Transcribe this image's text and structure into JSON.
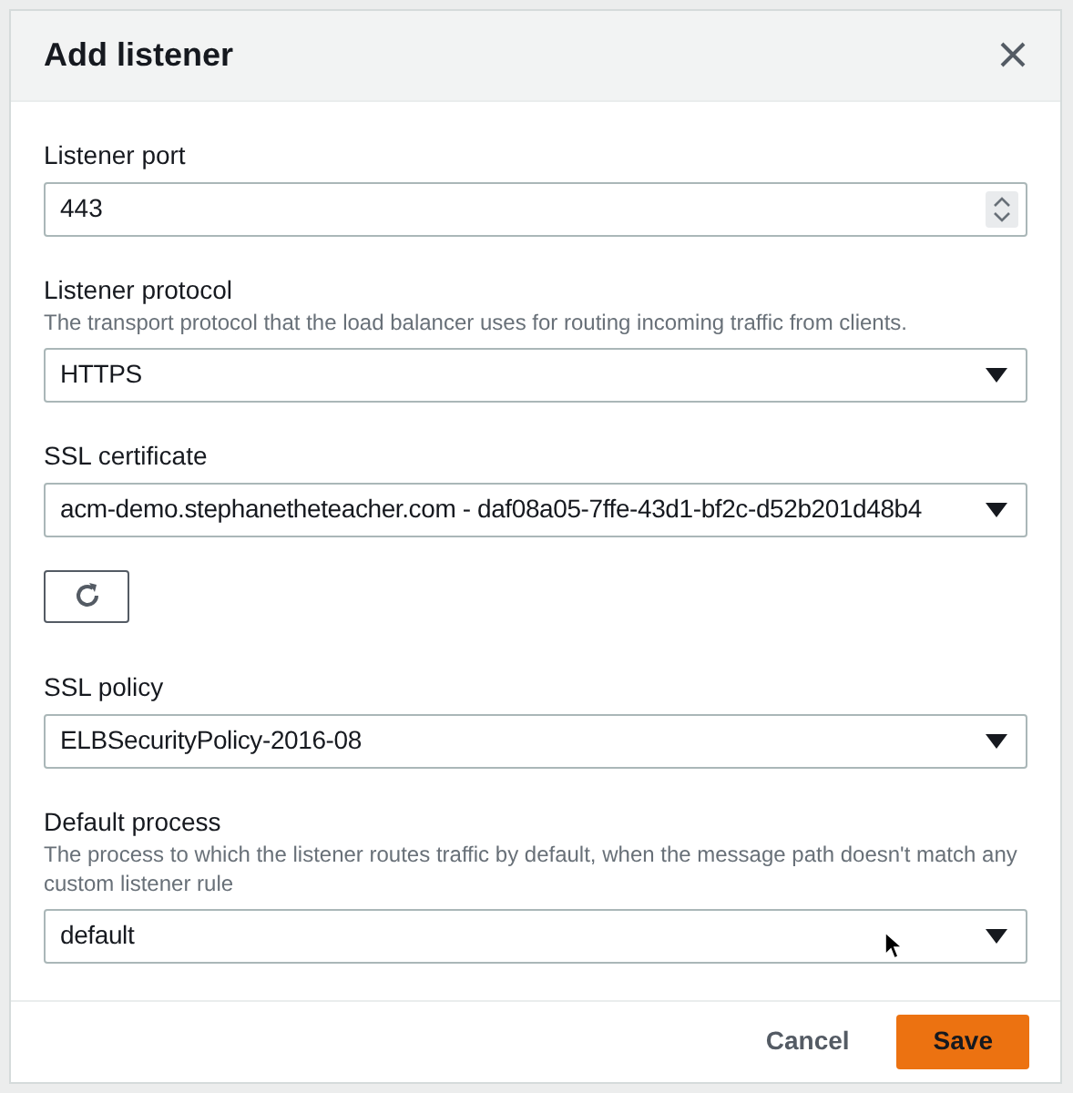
{
  "dialog": {
    "title": "Add listener"
  },
  "fields": [
    {
      "kind": "number",
      "label": "Listener port",
      "value": "443"
    },
    {
      "kind": "select",
      "label": "Listener protocol",
      "description": "The transport protocol that the load balancer uses for routing incoming traffic from clients.",
      "value": "HTTPS"
    },
    {
      "kind": "select",
      "label": "SSL certificate",
      "value": "acm-demo.stephanetheteacher.com - daf08a05-7ffe-43d1-bf2c-d52b201d48b4"
    },
    {
      "kind": "refresh"
    },
    {
      "kind": "select",
      "label": "SSL policy",
      "value": "ELBSecurityPolicy-2016-08"
    },
    {
      "kind": "select",
      "label": "Default process",
      "description": "The process to which the listener routes traffic by default, when the message path doesn't match any custom listener rule",
      "value": "default"
    }
  ],
  "buttons": [
    {
      "label": "Cancel",
      "kind": "link"
    },
    {
      "label": "Save",
      "kind": "primary"
    }
  ]
}
